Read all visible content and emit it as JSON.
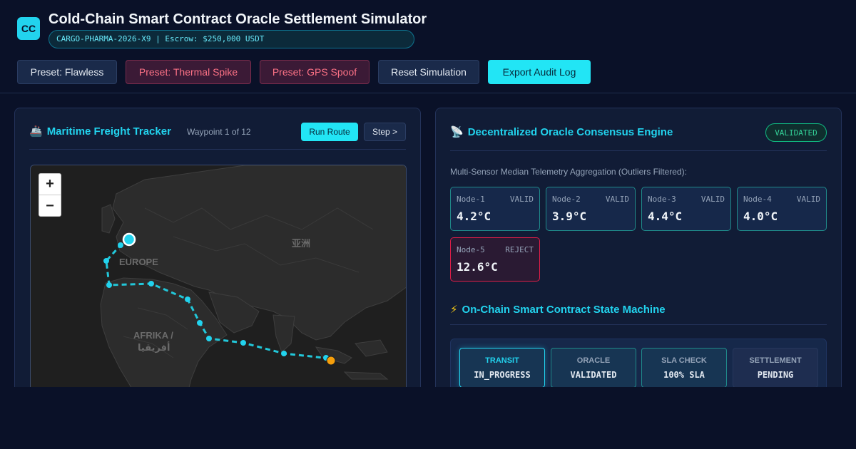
{
  "header": {
    "logo_text": "CC",
    "title": "Cold-Chain Smart Contract Oracle Settlement Simulator",
    "contract_info": "CARGO-PHARMA-2026-X9 | Escrow: $250,000 USDT"
  },
  "toolbar": {
    "preset_flawless": "Preset: Flawless",
    "preset_thermal": "Preset: Thermal Spike",
    "preset_gps": "Preset: GPS Spoof",
    "reset": "Reset Simulation",
    "export": "Export Audit Log"
  },
  "tracker": {
    "icon": "🚢",
    "title": "Maritime Freight Tracker",
    "waypoint": "Waypoint 1 of 12",
    "run_label": "Run Route",
    "step_label": "Step >",
    "map": {
      "zoom_in": "+",
      "zoom_out": "−",
      "label_europe": "EUROPE",
      "label_asia": "亚洲",
      "label_africa_1": "AFRIKA /",
      "label_africa_2": "أفريقيا"
    }
  },
  "oracle": {
    "icon": "📡",
    "title": "Decentralized Oracle Consensus Engine",
    "status_badge": "VALIDATED",
    "subtitle": "Multi-Sensor Median Telemetry Aggregation (Outliers Filtered):",
    "nodes": [
      {
        "name": "Node-1",
        "status": "VALID",
        "temp": "4.2°C"
      },
      {
        "name": "Node-2",
        "status": "VALID",
        "temp": "3.9°C"
      },
      {
        "name": "Node-3",
        "status": "VALID",
        "temp": "4.4°C"
      },
      {
        "name": "Node-4",
        "status": "VALID",
        "temp": "4.0°C"
      },
      {
        "name": "Node-5",
        "status": "REJECT",
        "temp": "12.6°C"
      }
    ]
  },
  "state_machine": {
    "icon": "⚡",
    "title": "On-Chain Smart Contract State Machine",
    "states": [
      {
        "label": "TRANSIT",
        "value": "IN_PROGRESS"
      },
      {
        "label": "ORACLE",
        "value": "VALIDATED"
      },
      {
        "label": "SLA CHECK",
        "value": "100% SLA"
      },
      {
        "label": "SETTLEMENT",
        "value": "PENDING"
      }
    ]
  },
  "colors": {
    "accent": "#22d3ee",
    "valid": "#34d399",
    "reject": "#e11d48",
    "background": "#0a1128"
  }
}
